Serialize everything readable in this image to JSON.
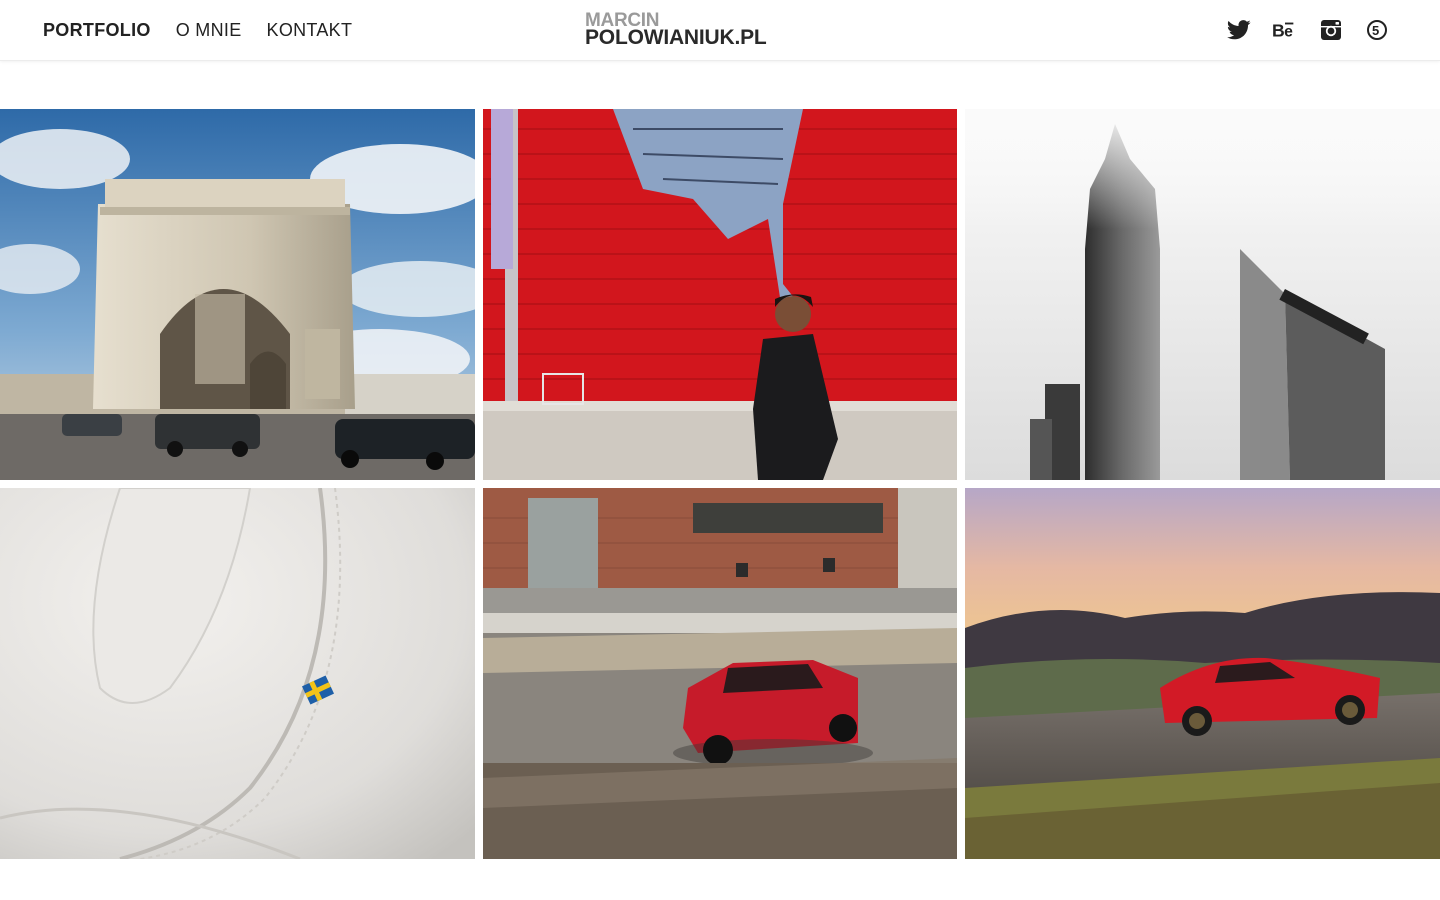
{
  "nav": {
    "items": [
      {
        "label": "PORTFOLIO",
        "active": true
      },
      {
        "label": "O MNIE",
        "active": false
      },
      {
        "label": "KONTAKT",
        "active": false
      }
    ]
  },
  "logo": {
    "line1": "MARCIN",
    "line2": "POLOWIANIUK.PL"
  },
  "social": [
    {
      "icon": "twitter-icon"
    },
    {
      "icon": "behance-icon"
    },
    {
      "icon": "instagram-icon"
    },
    {
      "icon": "500px-icon"
    }
  ],
  "gallery": [
    {
      "subject": "arc-de-triomphe"
    },
    {
      "subject": "red-wall-mural"
    },
    {
      "subject": "skyscrapers-fog"
    },
    {
      "subject": "leather-seat-swedish-flag"
    },
    {
      "subject": "red-hatchback-industrial"
    },
    {
      "subject": "red-sports-car-road"
    }
  ],
  "colors": {
    "text": "#222222",
    "logo_gray": "#9a9a9a",
    "accent_red": "#d0141a"
  }
}
